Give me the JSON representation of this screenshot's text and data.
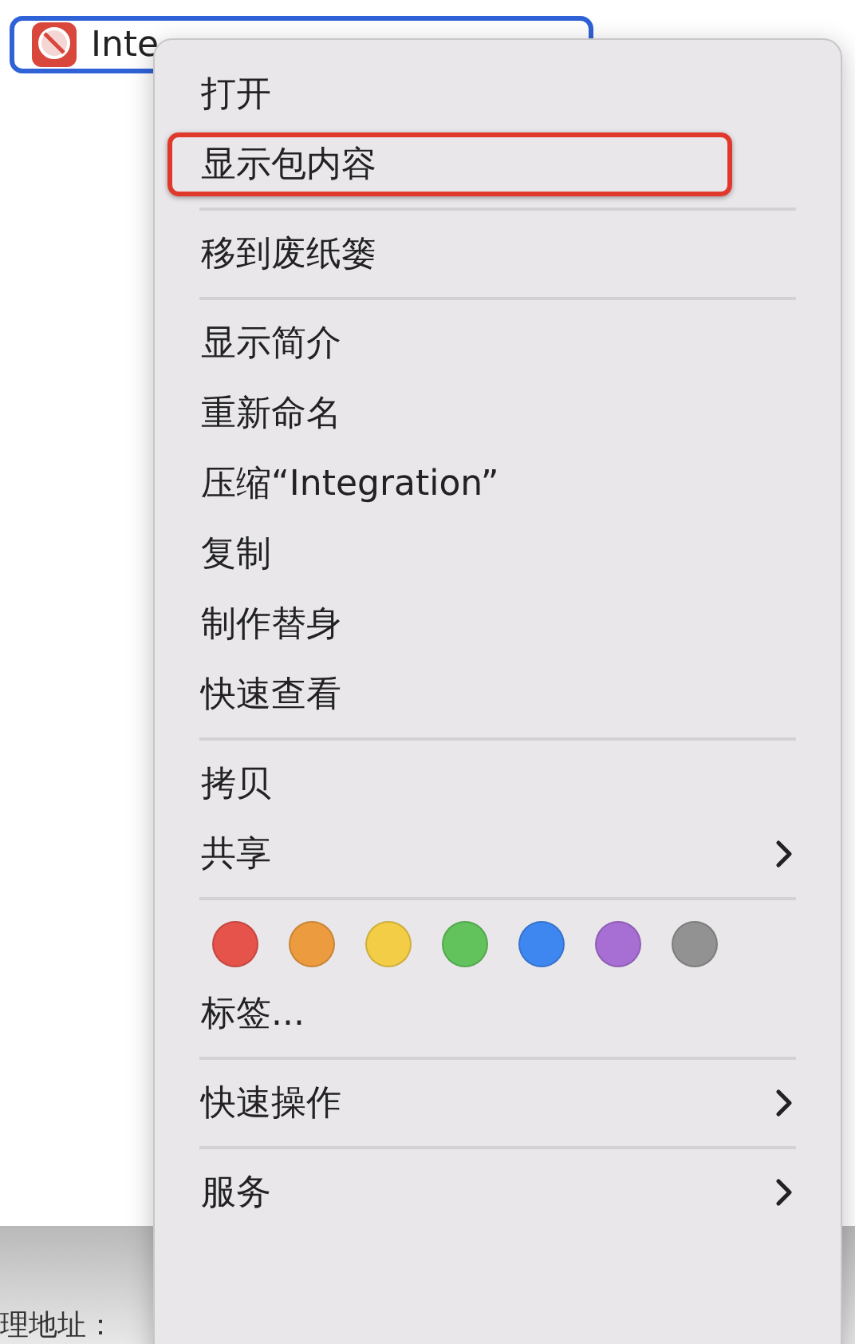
{
  "file_item": {
    "name": "Inte",
    "selected": true
  },
  "context_menu": {
    "items": [
      {
        "kind": "item",
        "label": "打开",
        "highlighted": false
      },
      {
        "kind": "item",
        "label": "显示包内容",
        "highlighted": true
      },
      {
        "kind": "separator"
      },
      {
        "kind": "item",
        "label": "移到废纸篓",
        "highlighted": false
      },
      {
        "kind": "separator"
      },
      {
        "kind": "item",
        "label": "显示简介",
        "highlighted": false
      },
      {
        "kind": "item",
        "label": "重新命名",
        "highlighted": false
      },
      {
        "kind": "item",
        "label": "压缩“Integration”",
        "highlighted": false
      },
      {
        "kind": "item",
        "label": "复制",
        "highlighted": false
      },
      {
        "kind": "item",
        "label": "制作替身",
        "highlighted": false
      },
      {
        "kind": "item",
        "label": "快速查看",
        "highlighted": false
      },
      {
        "kind": "separator"
      },
      {
        "kind": "item",
        "label": "拷贝",
        "highlighted": false
      },
      {
        "kind": "submenu",
        "label": "共享",
        "highlighted": false
      },
      {
        "kind": "separator"
      },
      {
        "kind": "tags",
        "tags": [
          {
            "color": "#e5534b"
          },
          {
            "color": "#ec9c3e"
          },
          {
            "color": "#f2cd45"
          },
          {
            "color": "#62c35c"
          },
          {
            "color": "#3f87f0"
          },
          {
            "color": "#a76ed4"
          },
          {
            "color": "#929292"
          }
        ]
      },
      {
        "kind": "item",
        "label": "标签...",
        "highlighted": false
      },
      {
        "kind": "separator"
      },
      {
        "kind": "submenu",
        "label": "快速操作",
        "highlighted": false
      },
      {
        "kind": "separator"
      },
      {
        "kind": "submenu",
        "label": "服务",
        "highlighted": false
      }
    ]
  },
  "background_text": "理地址："
}
